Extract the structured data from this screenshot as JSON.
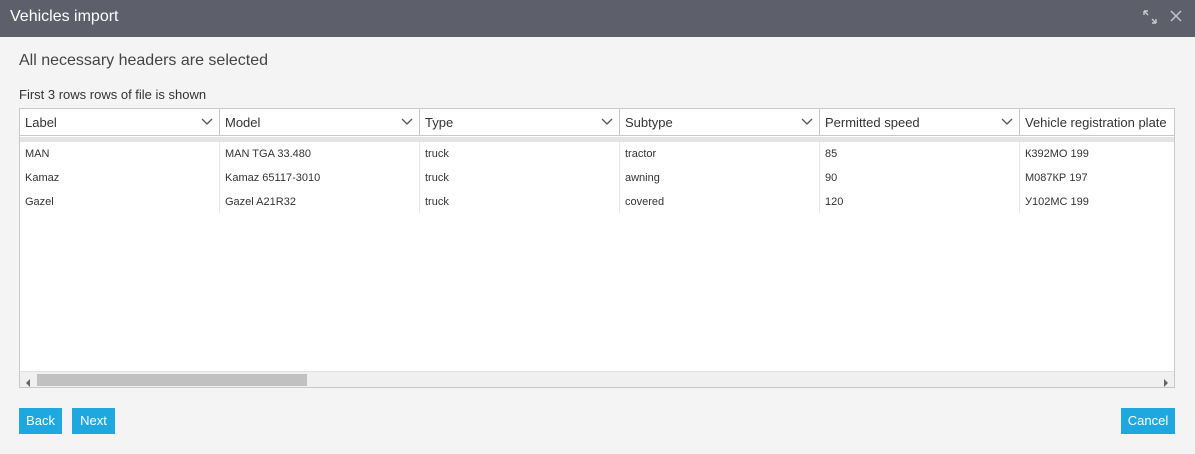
{
  "window": {
    "title": "Vehicles import",
    "expand_icon": "expand-arrows-icon",
    "close_icon": "close-icon"
  },
  "heading": "All necessary headers are selected",
  "subtitle": "First 3 rows rows of file is shown",
  "table": {
    "columns": [
      {
        "label": "Label"
      },
      {
        "label": "Model"
      },
      {
        "label": "Type"
      },
      {
        "label": "Subtype"
      },
      {
        "label": "Permitted speed"
      },
      {
        "label": "Vehicle registration plate"
      }
    ],
    "rows": [
      [
        "MAN",
        "MAN TGA 33.480",
        "truck",
        "tractor",
        "85",
        "К392МО 199"
      ],
      [
        "Kamaz",
        "Kamaz 65117-3010",
        "truck",
        "awning",
        "90",
        "М087КР 197"
      ],
      [
        "Gazel",
        "Gazel A21R32",
        "truck",
        "covered",
        "120",
        "У102МС 199"
      ]
    ],
    "scroll_position": 0
  },
  "buttons": {
    "back": "Back",
    "next": "Next",
    "cancel": "Cancel"
  },
  "colors": {
    "titlebar": "#5d5f6b",
    "accent": "#1fa8e0"
  }
}
